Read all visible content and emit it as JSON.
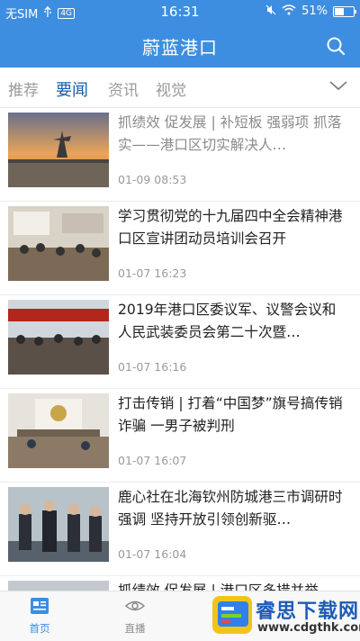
{
  "status_bar": {
    "carrier": "无SIM",
    "time": "16:31",
    "battery": "51%",
    "battery_level": 0.51,
    "network_badge": "4G"
  },
  "header": {
    "title": "蔚蓝港口",
    "search_icon": "search-icon"
  },
  "tabs": [
    {
      "label": "推荐",
      "active": false
    },
    {
      "label": "要闻",
      "active": true
    },
    {
      "label": "资讯",
      "active": false
    },
    {
      "label": "视觉",
      "active": false
    }
  ],
  "articles": [
    {
      "title": "抓绩效 促发展 | 补短板 强弱项 抓落实——港口区切实解决人…",
      "time": "01-09 08:53",
      "read": true
    },
    {
      "title": "学习贯彻党的十九届四中全会精神港口区宣讲团动员培训会召开",
      "time": "01-07 16:23",
      "read": false
    },
    {
      "title": "2019年港口区委议军、议警会议和人民武装委员会第二十次暨…",
      "time": "01-07 16:16",
      "read": false
    },
    {
      "title": "打击传销 | 打着“中国梦”旗号搞传销诈骗 一男子被判刑",
      "time": "01-07 16:07",
      "read": false
    },
    {
      "title": "鹿心社在北海钦州防城港三市调研时强调 坚持开放引领创新驱…",
      "time": "01-07 16:04",
      "read": false
    },
    {
      "title": "抓绩效 促发展 | 港口区多措并举",
      "time": "",
      "read": false
    }
  ],
  "bottom_nav": [
    {
      "label": "首页",
      "icon": "home-news-icon",
      "active": true
    },
    {
      "label": "直播",
      "icon": "eye-icon",
      "active": false
    }
  ],
  "watermark": {
    "title": "睿思下载网",
    "url": "www.cdgthk.com"
  },
  "colors": {
    "primary": "#3d8ee0",
    "tab_active": "#1b5fa8"
  }
}
